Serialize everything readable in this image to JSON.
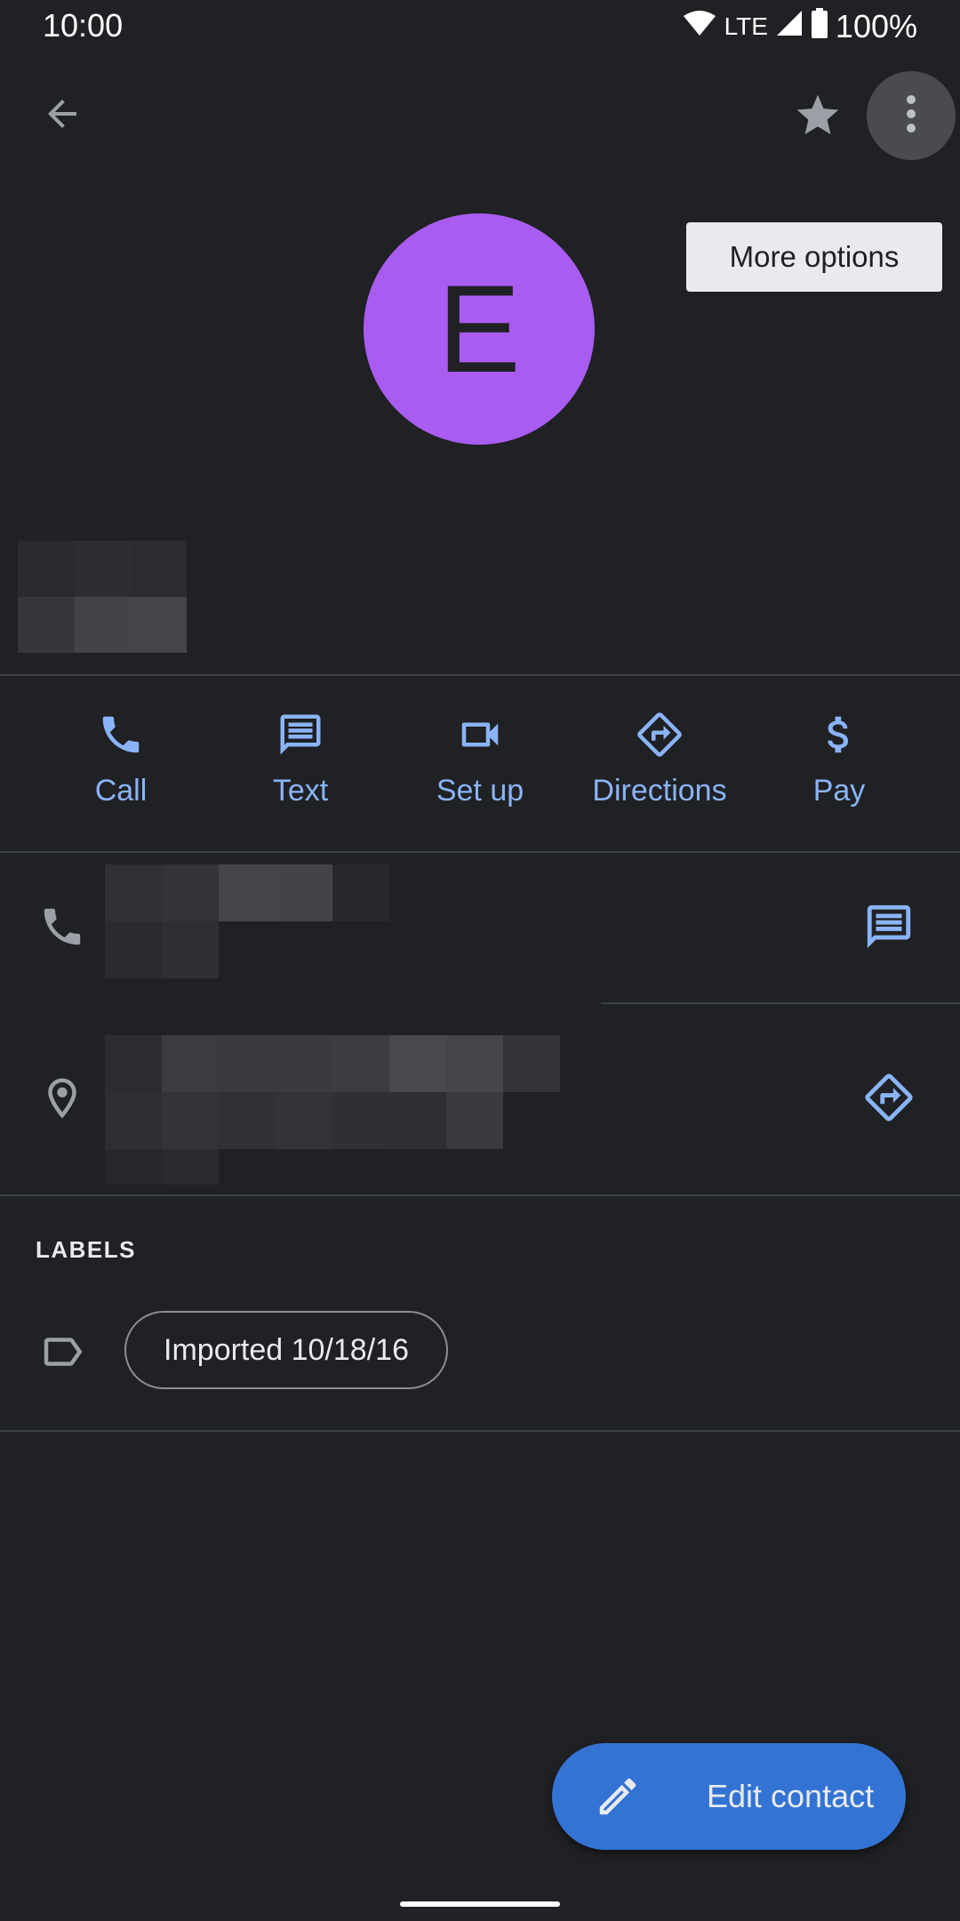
{
  "status_bar": {
    "time": "10:00",
    "network": "LTE",
    "battery": "100%"
  },
  "app_bar": {
    "back_icon": "arrow-back-icon",
    "star_icon": "star-icon",
    "more_icon": "more-vert-icon"
  },
  "tooltip": {
    "text": "More options"
  },
  "contact": {
    "avatar_letter": "E",
    "avatar_color": "#a95cf0"
  },
  "actions": [
    {
      "label": "Call",
      "icon": "phone-icon"
    },
    {
      "label": "Text",
      "icon": "message-icon"
    },
    {
      "label": "Set up",
      "icon": "videocam-icon"
    },
    {
      "label": "Directions",
      "icon": "directions-icon"
    },
    {
      "label": "Pay",
      "icon": "dollar-icon"
    }
  ],
  "labels": {
    "header": "LABELS",
    "chip": "Imported 10/18/16"
  },
  "fab": {
    "label": "Edit contact",
    "icon": "pencil-icon",
    "color": "#3373d4"
  },
  "colors": {
    "background": "#202124",
    "accent": "#8ab4f8"
  }
}
